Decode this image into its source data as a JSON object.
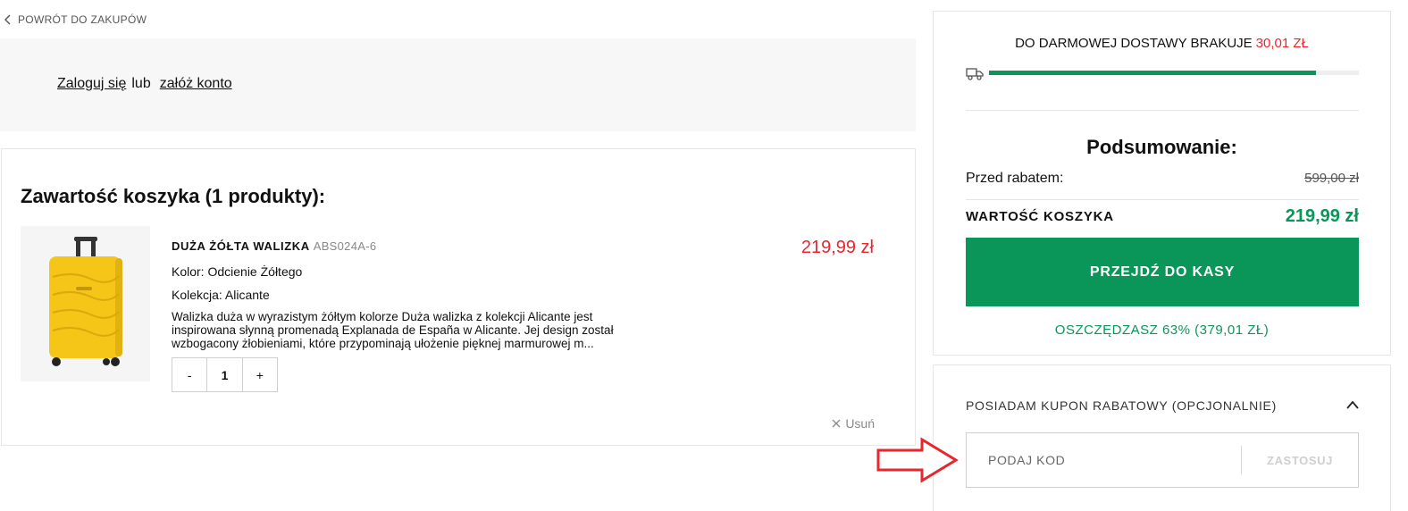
{
  "back_link": {
    "label": "POWRÓT DO ZAKUPÓW",
    "icon": "chevron-left-icon"
  },
  "login": {
    "login_link": "Zaloguj się",
    "separator": "lub",
    "register_link": "załóż konto"
  },
  "cart": {
    "title": "Zawartość koszyka (1 produkty):",
    "product": {
      "name": "DUŻA ŻÓŁTA WALIZKA",
      "sku": "ABS024A-6",
      "color": "Kolor: Odcienie Żółtego",
      "collection": "Kolekcja: Alicante",
      "description": "Walizka duża w wyrazistym żółtym kolorze Duża walizka z kolekcji Alicante jest inspirowana słynną promenadą Explanada de España w Alicante. Jej design został wzbogacony żłobieniami, które przypominają ułożenie pięknej marmurowej m...",
      "price": "219,99 zł",
      "quantity": "1",
      "minus_label": "-",
      "plus_label": "+",
      "remove_label": "Usuń",
      "image_icon": "yellow-suitcase-image"
    }
  },
  "summary": {
    "shipping_text": "DO DARMOWEJ DOSTAWY BRAKUJE",
    "shipping_missing": "30,01 ZŁ",
    "shipping_progress": 0.883,
    "title": "Podsumowanie:",
    "before_discount_label": "Przed rabatem:",
    "before_discount_value": "599,00 zł",
    "cart_value_label": "WARTOŚĆ KOSZYKA",
    "cart_value": "219,99 zł",
    "checkout_label": "PRZEJDŹ DO KASY",
    "savings": "OSZCZĘDZASZ 63% (379,01 ZŁ)"
  },
  "coupon": {
    "title": "POSIADAM KUPON RABATOWY (OPCJONALNIE)",
    "placeholder": "PODAJ KOD",
    "apply_label": "ZASTOSUJ"
  },
  "colors": {
    "accent_green": "#0a9659",
    "price_red": "#e8262d",
    "annotation_red": "#e8262d"
  }
}
